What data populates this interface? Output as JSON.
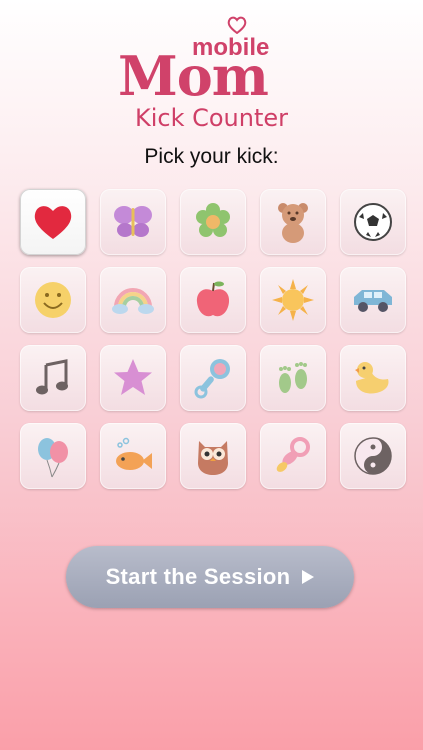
{
  "app": {
    "logo_word_small": "mobile",
    "logo_word_big": "Mom",
    "subtitle": "Kick Counter"
  },
  "prompt": "Pick your kick:",
  "kicks": [
    "heart-icon",
    "butterfly-icon",
    "flower-icon",
    "teddy-bear-icon",
    "soccer-ball-icon",
    "smiley-icon",
    "rainbow-icon",
    "apple-icon",
    "sun-icon",
    "car-icon",
    "music-note-icon",
    "star-icon",
    "rattle-icon",
    "footprints-icon",
    "duck-icon",
    "balloons-icon",
    "fish-icon",
    "owl-icon",
    "pacifier-icon",
    "yin-yang-icon"
  ],
  "selected_kick": "heart-icon",
  "start_button": {
    "label": "Start the Session"
  },
  "colors": {
    "brand": "#d0426a",
    "button": "#a3a9ba"
  }
}
